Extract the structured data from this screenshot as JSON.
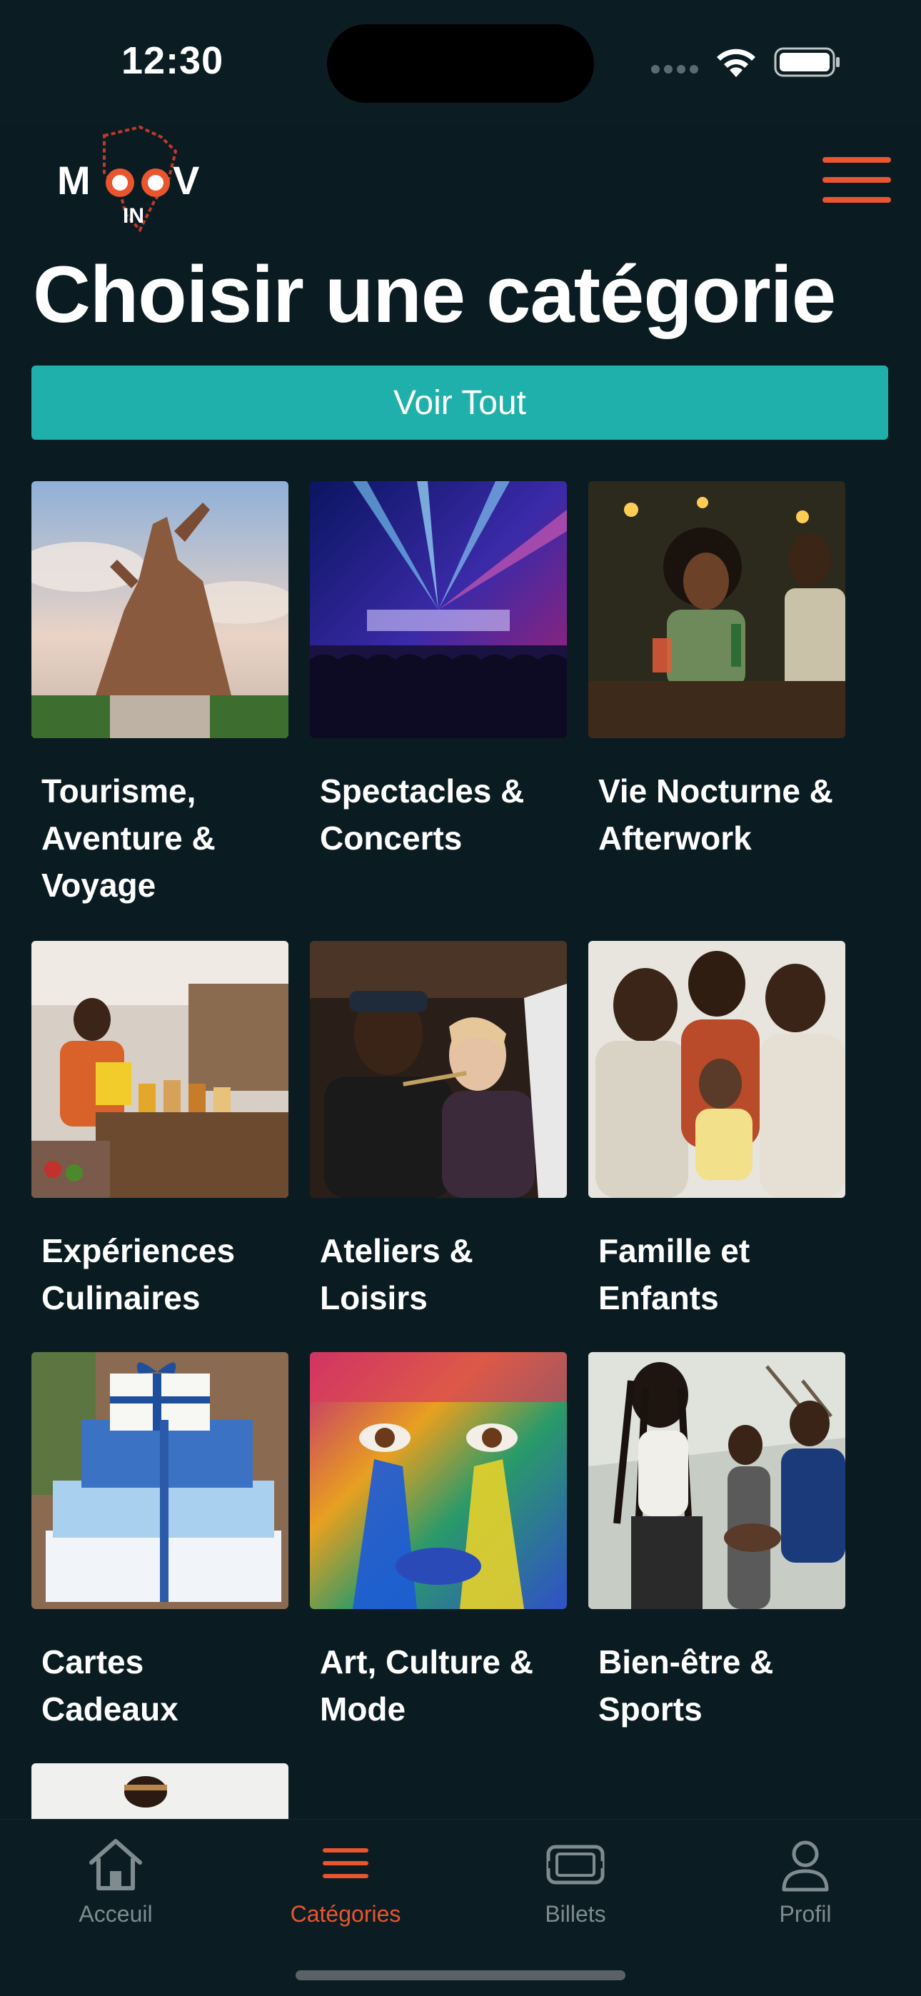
{
  "status": {
    "time": "12:30"
  },
  "header": {
    "logo_text": "MOOV",
    "logo_sub": "IN",
    "menu_icon": "hamburger-menu-icon"
  },
  "title": "Choisir une catégorie",
  "voir_tout": "Voir Tout",
  "categories": [
    {
      "label": "Tourisme, Aventure & Voyage",
      "image": "monument-photo"
    },
    {
      "label": "Spectacles & Concerts",
      "image": "concert-photo"
    },
    {
      "label": "Vie Nocturne & Afterwork",
      "image": "nightlife-photo"
    },
    {
      "label": "Expériences Culinaires",
      "image": "market-photo"
    },
    {
      "label": "Ateliers & Loisirs",
      "image": "painting-photo"
    },
    {
      "label": "Famille et Enfants",
      "image": "family-photo"
    },
    {
      "label": "Cartes Cadeaux",
      "image": "gift-boxes-photo"
    },
    {
      "label": "Art, Culture & Mode",
      "image": "painted-face-photo"
    },
    {
      "label": "Bien-être & Sports",
      "image": "fitness-photo"
    },
    {
      "label": "",
      "image": "partial-photo"
    }
  ],
  "nav": [
    {
      "label": "Acceuil",
      "icon": "home-icon",
      "active": false
    },
    {
      "label": "Catégories",
      "icon": "categories-icon",
      "active": true
    },
    {
      "label": "Billets",
      "icon": "ticket-icon",
      "active": false
    },
    {
      "label": "Profil",
      "icon": "profile-icon",
      "active": false
    }
  ],
  "colors": {
    "background": "#0a1c22",
    "accent": "#e8552e",
    "button": "#1fb0ab"
  }
}
